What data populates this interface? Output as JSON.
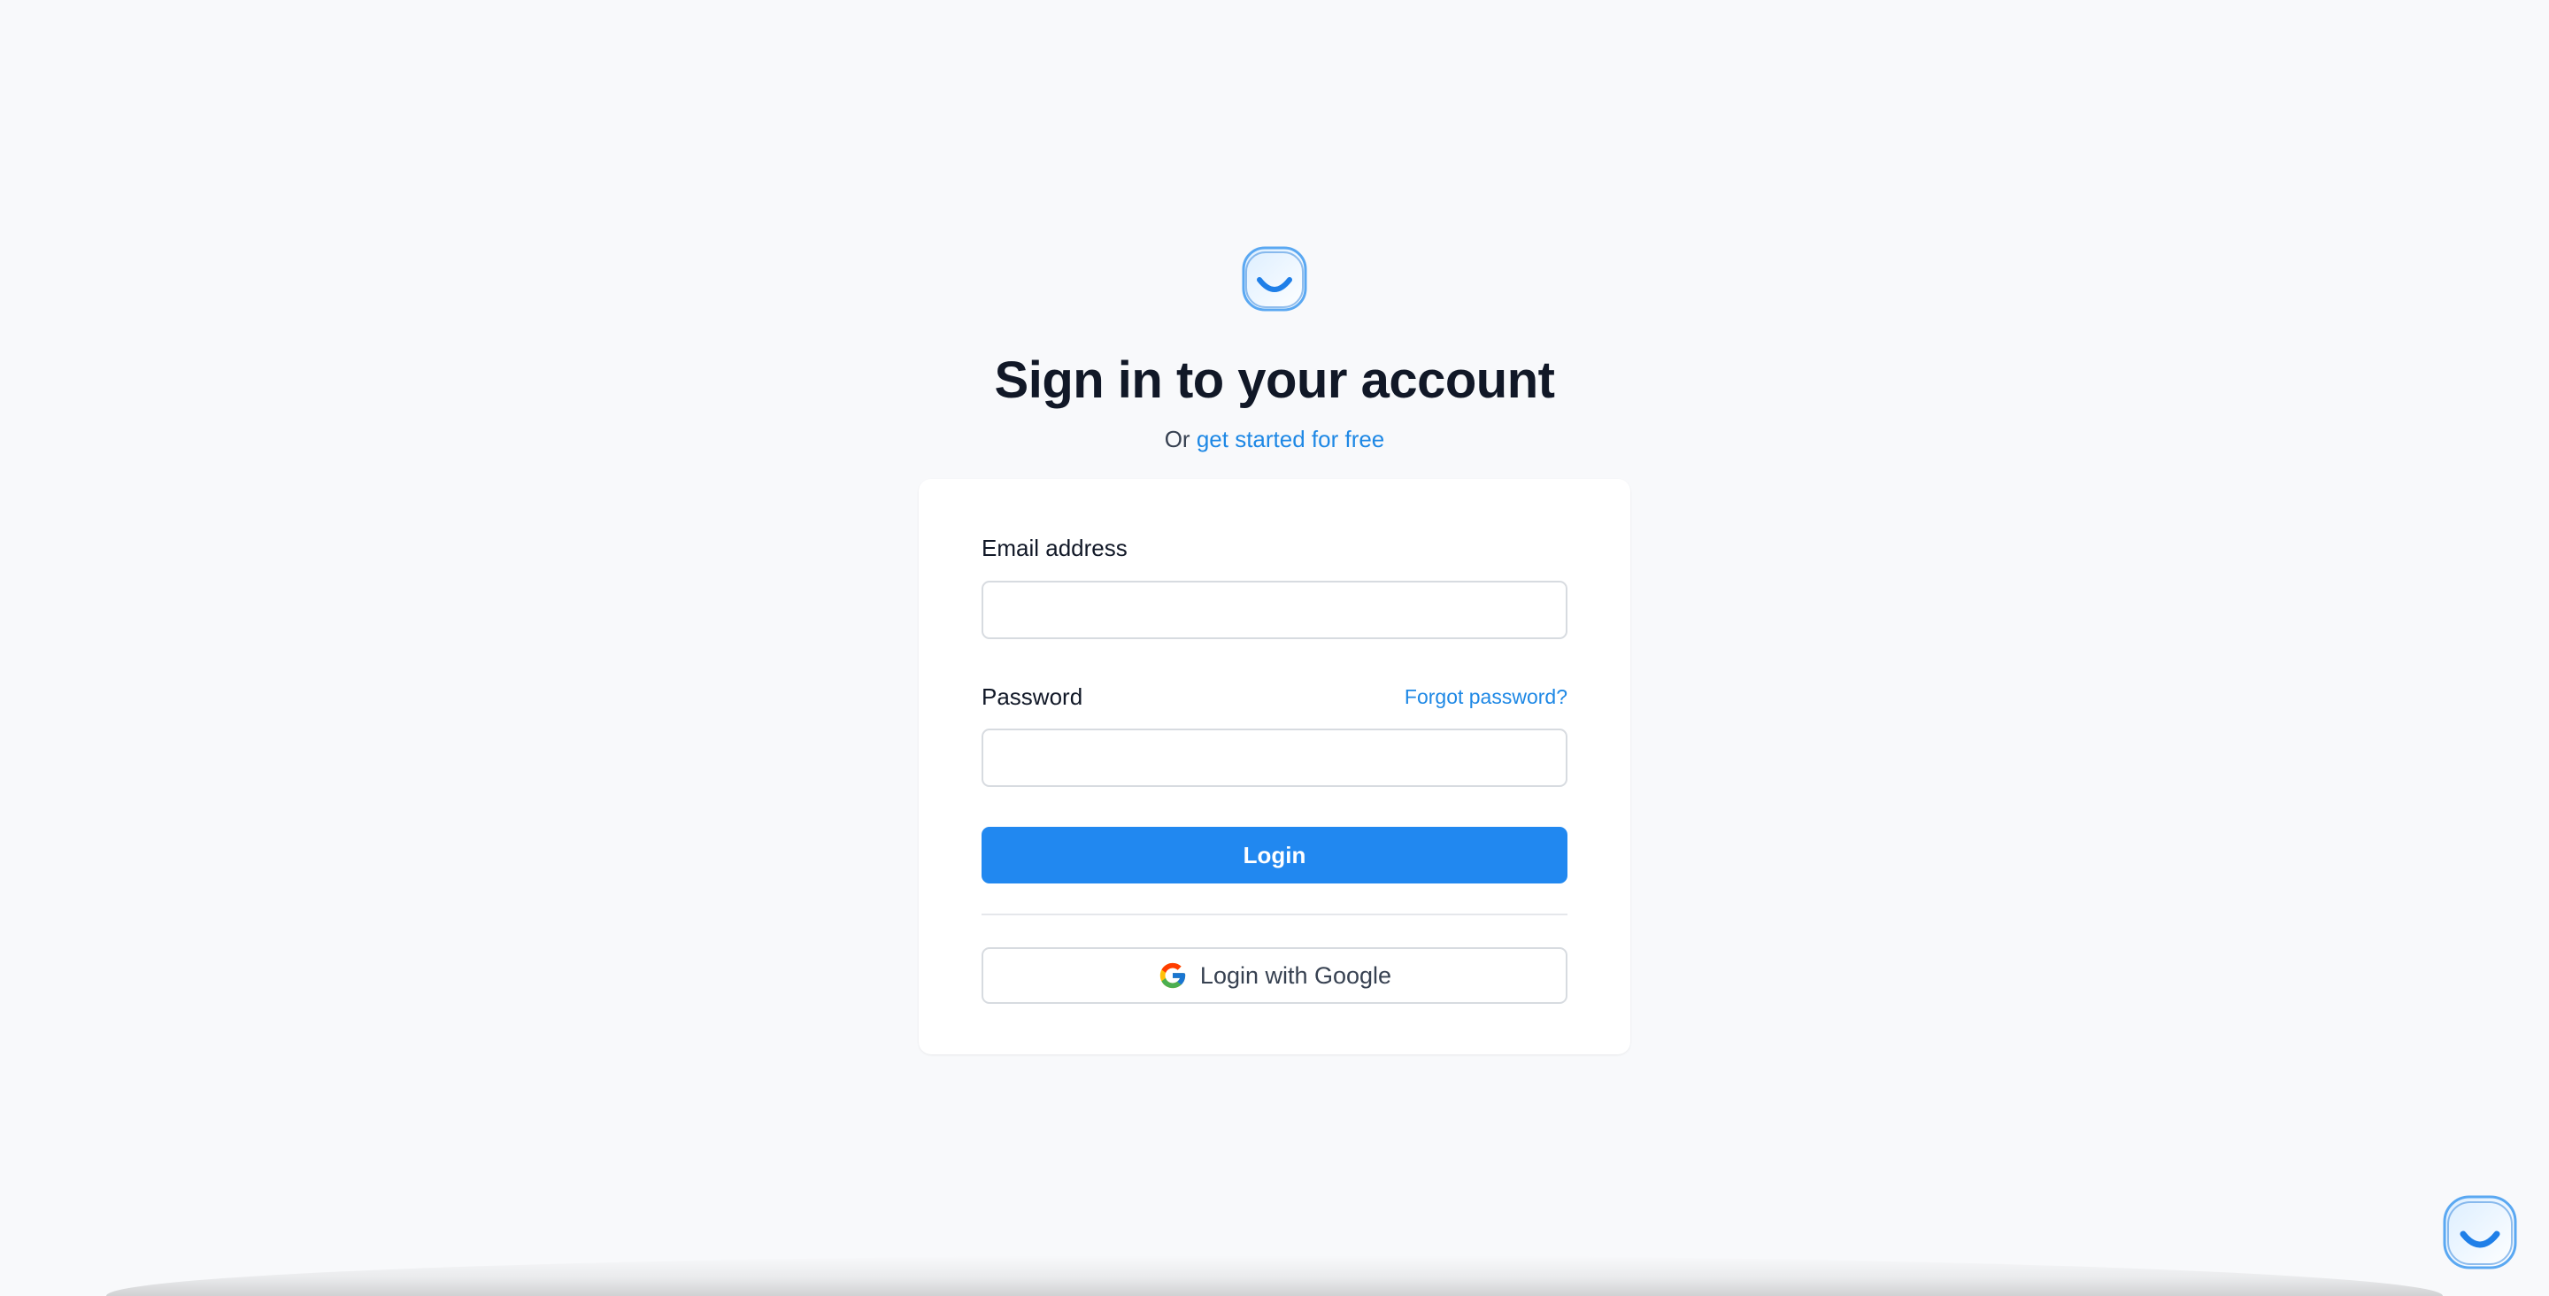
{
  "brand": {
    "logo_icon": "smile-logo-icon",
    "accent_color": "#2188f0",
    "link_color": "#1e88e5"
  },
  "heading": {
    "title": "Sign in to your account",
    "subtitle_prefix": "Or",
    "subtitle_link": "get started for free"
  },
  "form": {
    "email_label": "Email address",
    "email_value": "",
    "password_label": "Password",
    "password_value": "",
    "forgot_link": "Forgot password?",
    "login_button": "Login",
    "google_button": "Login with Google",
    "google_icon": "google-icon"
  },
  "chat": {
    "icon": "smile-chat-icon"
  }
}
